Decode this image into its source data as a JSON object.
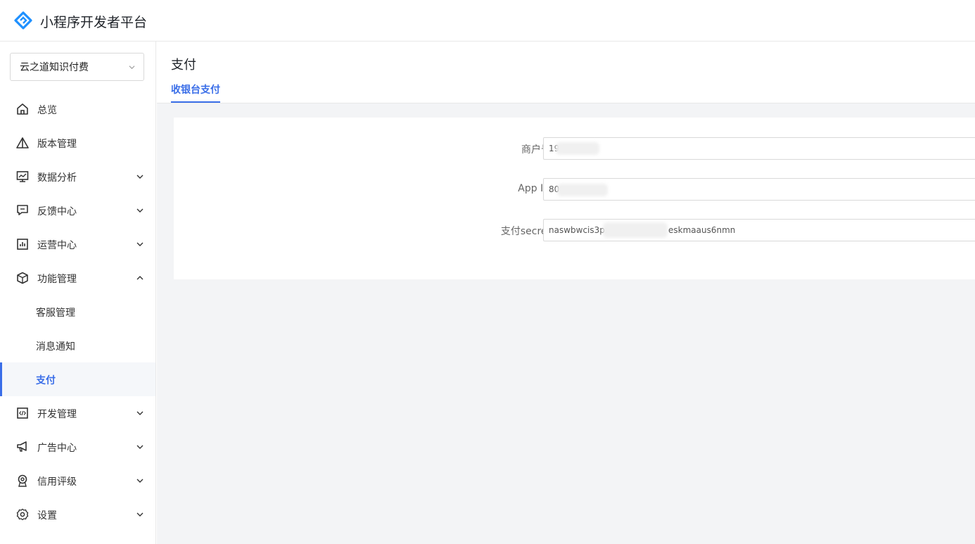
{
  "header": {
    "app_title": "小程序开发者平台"
  },
  "sidebar": {
    "app_select": "云之道知识付费",
    "items": [
      {
        "label": "总览",
        "icon": "home-icon",
        "has_arrow": false
      },
      {
        "label": "版本管理",
        "icon": "version-icon",
        "has_arrow": false
      },
      {
        "label": "数据分析",
        "icon": "chart-icon",
        "has_arrow": true,
        "expanded": false
      },
      {
        "label": "反馈中心",
        "icon": "feedback-icon",
        "has_arrow": true,
        "expanded": false
      },
      {
        "label": "运营中心",
        "icon": "operation-icon",
        "has_arrow": true,
        "expanded": false
      },
      {
        "label": "功能管理",
        "icon": "cube-icon",
        "has_arrow": true,
        "expanded": true
      },
      {
        "label": "开发管理",
        "icon": "code-icon",
        "has_arrow": true,
        "expanded": false
      },
      {
        "label": "广告中心",
        "icon": "megaphone-icon",
        "has_arrow": true,
        "expanded": false
      },
      {
        "label": "信用评级",
        "icon": "credit-icon",
        "has_arrow": true,
        "expanded": false
      },
      {
        "label": "设置",
        "icon": "settings-icon",
        "has_arrow": true,
        "expanded": false
      }
    ],
    "sub_items": [
      {
        "label": "客服管理",
        "active": false
      },
      {
        "label": "消息通知",
        "active": false
      },
      {
        "label": "支付",
        "active": true
      }
    ]
  },
  "main": {
    "page_title": "支付",
    "tabs": [
      {
        "label": "收银台支付",
        "active": true
      }
    ],
    "form": {
      "merchant_label": "商户号",
      "merchant_value": "19",
      "appid_label": "App ID",
      "appid_value": "80",
      "secret_label": "支付secret",
      "secret_value": "naswbwcis3pr",
      "secret_value_tail": "eskmaaus6nmn"
    }
  },
  "colors": {
    "accent": "#3a6ee8",
    "background": "#f3f4f6"
  }
}
